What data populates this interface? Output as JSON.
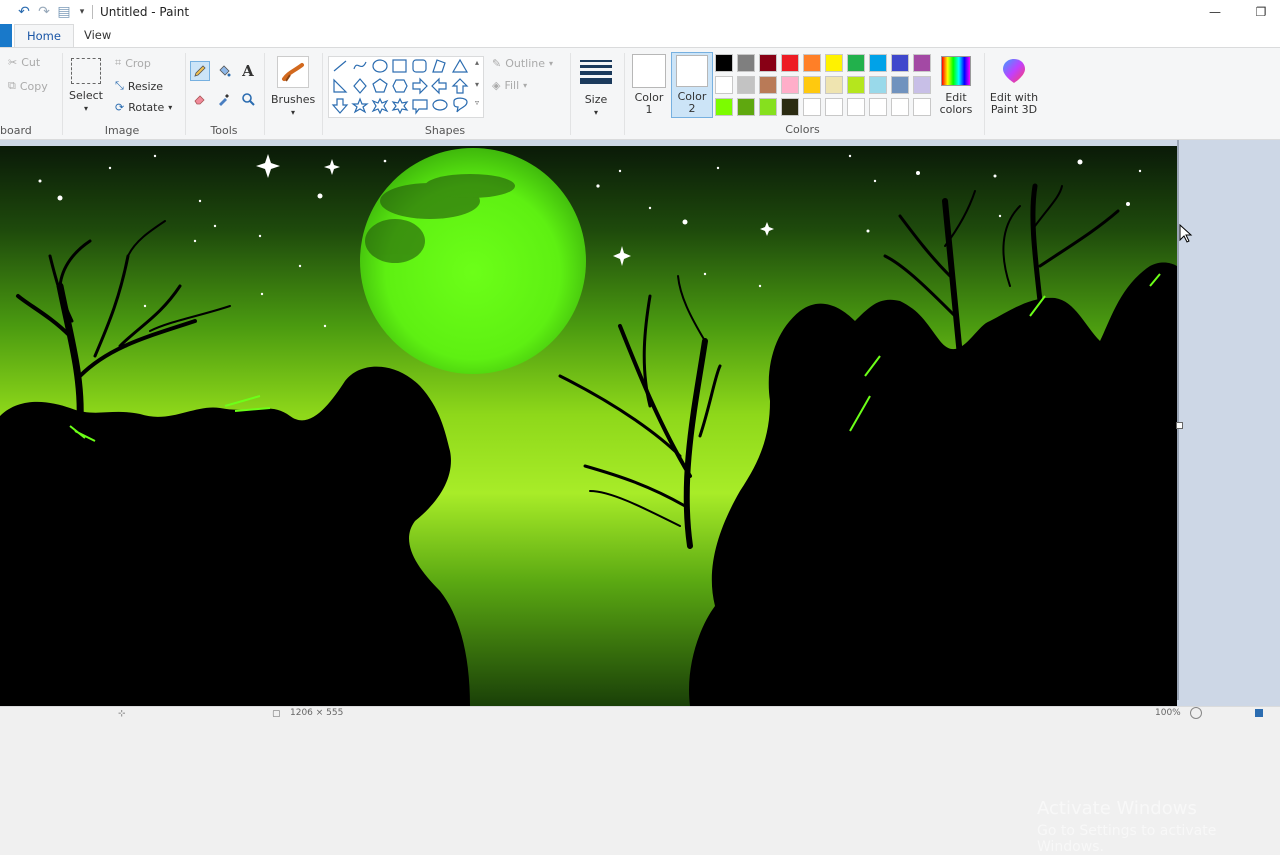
{
  "window": {
    "title": "Untitled - Paint"
  },
  "tabs": [
    {
      "label": "Home",
      "active": true
    },
    {
      "label": "View",
      "active": false
    }
  ],
  "clipboard": {
    "cut": "Cut",
    "copy": "Copy",
    "group": "board"
  },
  "image": {
    "select": "Select",
    "crop": "Crop",
    "resize": "Resize",
    "rotate": "Rotate",
    "group": "Image"
  },
  "tools": {
    "group": "Tools"
  },
  "brushes": {
    "label": "Brushes"
  },
  "shapes": {
    "outline": "Outline",
    "fill": "Fill",
    "group": "Shapes"
  },
  "size": {
    "label": "Size"
  },
  "colors": {
    "color1_line1": "Color",
    "color1_line2": "1",
    "color2_line1": "Color",
    "color2_line2": "2",
    "edit_line1": "Edit",
    "edit_line2": "colors",
    "group": "Colors",
    "palette_row1": [
      "#000000",
      "#7f7f7f",
      "#880015",
      "#ed1c24",
      "#ff7f27",
      "#fff200",
      "#22b14c",
      "#00a2e8",
      "#3f48cc",
      "#a349a4"
    ],
    "palette_row2": [
      "#ffffff",
      "#c3c3c3",
      "#b97a57",
      "#ffaec9",
      "#ffc90e",
      "#efe4b0",
      "#b5e61d",
      "#99d9ea",
      "#7092be",
      "#c8bfe7"
    ],
    "palette_row3": [
      "#7cfc00",
      "#5fa80f",
      "#86e01e",
      "#2b2b12",
      "#ffffff",
      "#ffffff",
      "#ffffff",
      "#ffffff",
      "#ffffff",
      "#ffffff"
    ]
  },
  "paint3d": {
    "line1": "Edit with",
    "line2": "Paint 3D"
  },
  "watermark": {
    "line1": "Activate Windows",
    "line2": "Go to Settings to activate Windows."
  },
  "status": {
    "zoom": "100%",
    "size_text": "1206 × 555"
  }
}
